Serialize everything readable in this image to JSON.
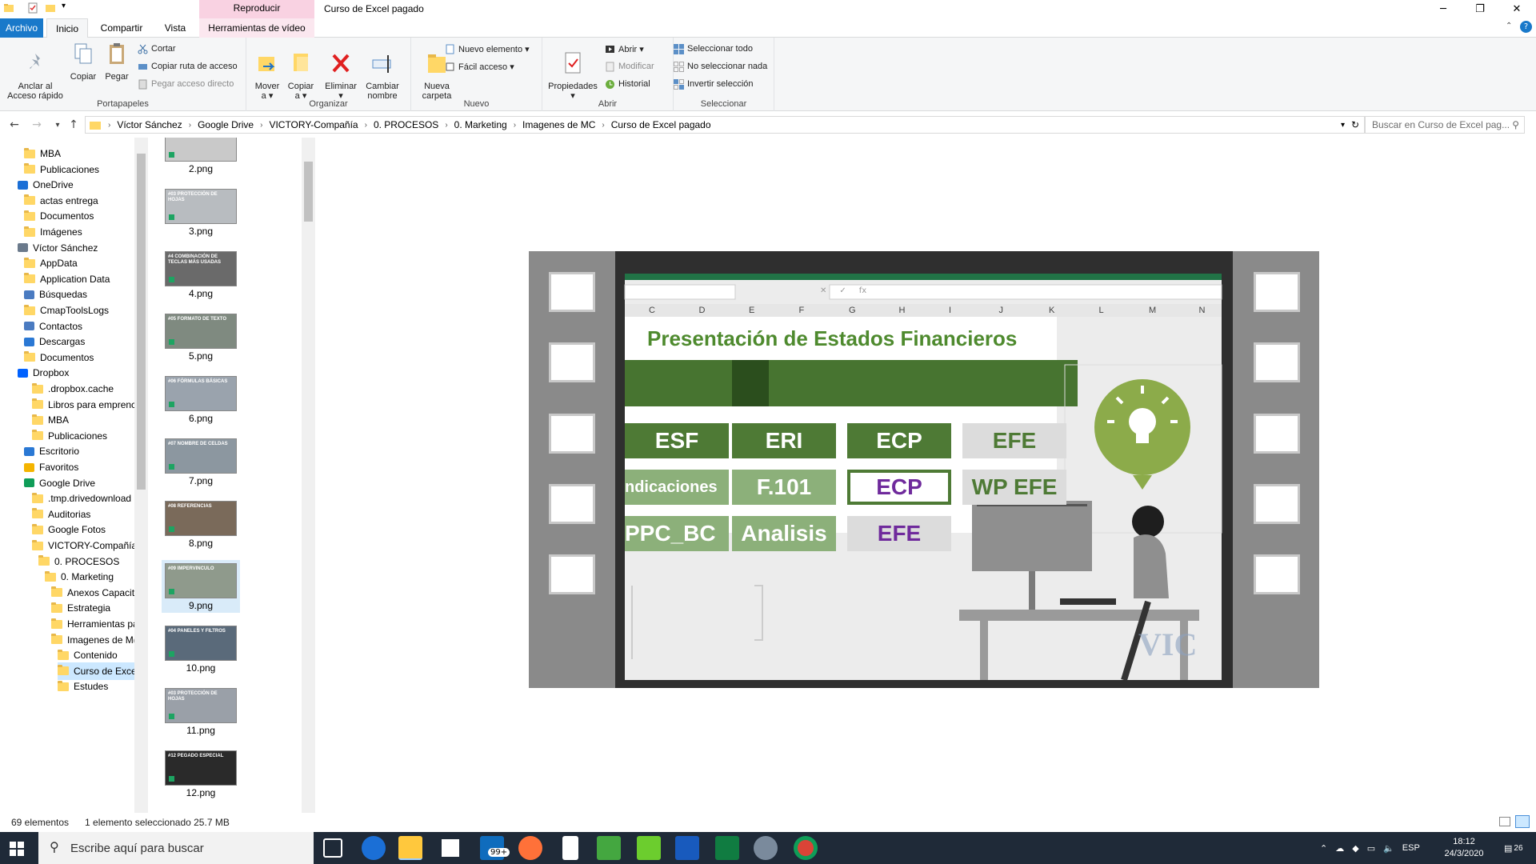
{
  "window": {
    "title": "Curso de Excel pagado",
    "context_group": "Reproducir"
  },
  "tabs": [
    {
      "label": "Archivo"
    },
    {
      "label": "Inicio"
    },
    {
      "label": "Compartir"
    },
    {
      "label": "Vista"
    },
    {
      "label": "Herramientas de vídeo"
    }
  ],
  "ribbon": {
    "portapapeles": {
      "label": "Portapapeles",
      "pin": "Anclar al\nAcceso rápido",
      "copy": "Copiar",
      "paste": "Pegar",
      "cut": "Cortar",
      "copy_path": "Copiar ruta de acceso",
      "paste_shortcut": "Pegar acceso directo"
    },
    "organizar": {
      "label": "Organizar",
      "move": "Mover\na ▾",
      "copy_to": "Copiar\na ▾",
      "delete": "Eliminar\n▾",
      "rename": "Cambiar\nnombre"
    },
    "nuevo": {
      "label": "Nuevo",
      "new_folder": "Nueva\ncarpeta",
      "new_item": "Nuevo elemento ▾",
      "easy_access": "Fácil acceso ▾"
    },
    "abrir": {
      "label": "Abrir",
      "properties": "Propiedades\n▾",
      "open": "Abrir ▾",
      "edit": "Modificar",
      "history": "Historial"
    },
    "seleccionar": {
      "label": "Seleccionar",
      "select_all": "Seleccionar todo",
      "select_none": "No seleccionar nada",
      "invert": "Invertir selección"
    }
  },
  "address": {
    "crumbs": [
      "Víctor Sánchez",
      "Google Drive",
      "VICTORY-Compañía",
      "0. PROCESOS",
      "0. Marketing",
      "Imagenes de MC",
      "Curso de Excel pagado"
    ],
    "search_placeholder": "Buscar en Curso de Excel pag..."
  },
  "nav": [
    {
      "label": "MBA"
    },
    {
      "label": "Publicaciones"
    },
    {
      "label": "OneDrive"
    },
    {
      "label": "actas entrega"
    },
    {
      "label": "Documentos"
    },
    {
      "label": "Imágenes"
    },
    {
      "label": "Víctor Sánchez"
    },
    {
      "label": "AppData"
    },
    {
      "label": "Application Data"
    },
    {
      "label": "Búsquedas"
    },
    {
      "label": "CmapToolsLogs"
    },
    {
      "label": "Contactos"
    },
    {
      "label": "Descargas"
    },
    {
      "label": "Documentos"
    },
    {
      "label": "Dropbox"
    },
    {
      "label": ".dropbox.cache"
    },
    {
      "label": "Libros para emprenc"
    },
    {
      "label": "MBA"
    },
    {
      "label": "Publicaciones"
    },
    {
      "label": "Escritorio"
    },
    {
      "label": "Favoritos"
    },
    {
      "label": "Google Drive"
    },
    {
      "label": ".tmp.drivedownload"
    },
    {
      "label": "Auditorias"
    },
    {
      "label": "Google Fotos"
    },
    {
      "label": "VICTORY-Compañía"
    },
    {
      "label": "0. PROCESOS"
    },
    {
      "label": "0. Marketing"
    },
    {
      "label": "Anexos Capacit"
    },
    {
      "label": "Estrategia"
    },
    {
      "label": "Herramientas pa"
    },
    {
      "label": "Imagenes de M("
    },
    {
      "label": "Contenido"
    },
    {
      "label": "Curso de Exce"
    },
    {
      "label": "Estudes"
    }
  ],
  "files": [
    {
      "name": "2.png",
      "caption": ""
    },
    {
      "name": "3.png",
      "caption": "#03 PROTECCIÓN DE HOJAS"
    },
    {
      "name": "4.png",
      "caption": "#4 COMBINACIÓN DE TECLAS MÁS USADAS"
    },
    {
      "name": "5.png",
      "caption": "#05 FORMATO DE TEXTO"
    },
    {
      "name": "6.png",
      "caption": "#06 FÓRMULAS BÁSICAS"
    },
    {
      "name": "7.png",
      "caption": "#07 NOMBRE DE CELDAS"
    },
    {
      "name": "8.png",
      "caption": "#08 REFERENCIAS"
    },
    {
      "name": "9.png",
      "caption": "#09 IMPERVINCULO"
    },
    {
      "name": "10.png",
      "caption": "#04 PANELES Y FILTROS"
    },
    {
      "name": "11.png",
      "caption": "#03 PROTECCIÓN DE HOJAS"
    },
    {
      "name": "12.png",
      "caption": "#12 PEGADO ESPECIAL"
    }
  ],
  "preview": {
    "title": "Presentación de Estados Financieros",
    "columns": [
      "C",
      "D",
      "E",
      "F",
      "G",
      "H",
      "I",
      "J",
      "K",
      "L",
      "M",
      "N"
    ],
    "tiles": [
      "ESF",
      "ERI",
      "ECP",
      "EFE",
      "ndicaciones",
      "F.101",
      "ECP",
      "WP EFE",
      "PPC_BC",
      "Analisis",
      "EFE"
    ],
    "watermark": "VIC",
    "formula_symbols": [
      "✕",
      "✓",
      "fx"
    ]
  },
  "status": {
    "count": "69 elementos",
    "selection": "1 elemento seleccionado  25.7 MB"
  },
  "taskbar": {
    "search": "Escribe aquí para buscar",
    "mail_badge": "99+",
    "lang": "ESP",
    "time": "18:12",
    "date": "24/3/2020",
    "notif": "26"
  },
  "colors": {
    "accent": "#1979ca",
    "excel_green": "#217346",
    "tile_dark": "#4e7a35",
    "tile_mid": "#8cb07a",
    "tile_light": "#dcdcdc",
    "bulb": "#8cab4a"
  }
}
